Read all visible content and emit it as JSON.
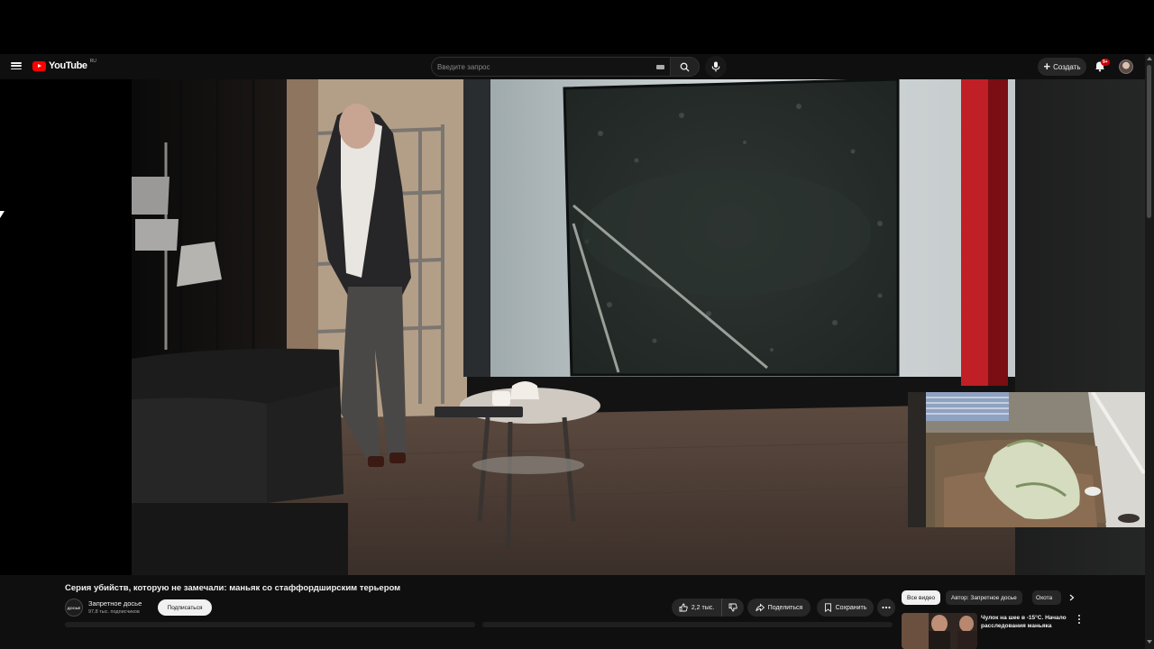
{
  "masthead": {
    "logo_text": "YouTube",
    "logo_region": "RU",
    "search_placeholder": "Введите запрос",
    "create_label": "Создать",
    "notifications_badge": "9+"
  },
  "video": {
    "title": "Серия убийств, которую не замечали: маньяк со стаффордширским терьером",
    "channel_name": "Запретное досье",
    "channel_avatar_text": "ДОСЬЕ",
    "subscribers": "97,8 тыс. подписчиков",
    "subscribe_label": "Подписаться",
    "likes": "2,2 тыс.",
    "share_label": "Поделиться",
    "save_label": "Сохранить"
  },
  "recommendations": {
    "chips": [
      "Все видео",
      "Автор: Запретное досье",
      "Охота"
    ],
    "items": [
      {
        "title": "Чулок на шее в -15°С. Начало расследования маньяка"
      }
    ]
  },
  "colors": {
    "brand_red": "#ff0000",
    "background": "#0f0f0f",
    "pill": "#272727"
  }
}
